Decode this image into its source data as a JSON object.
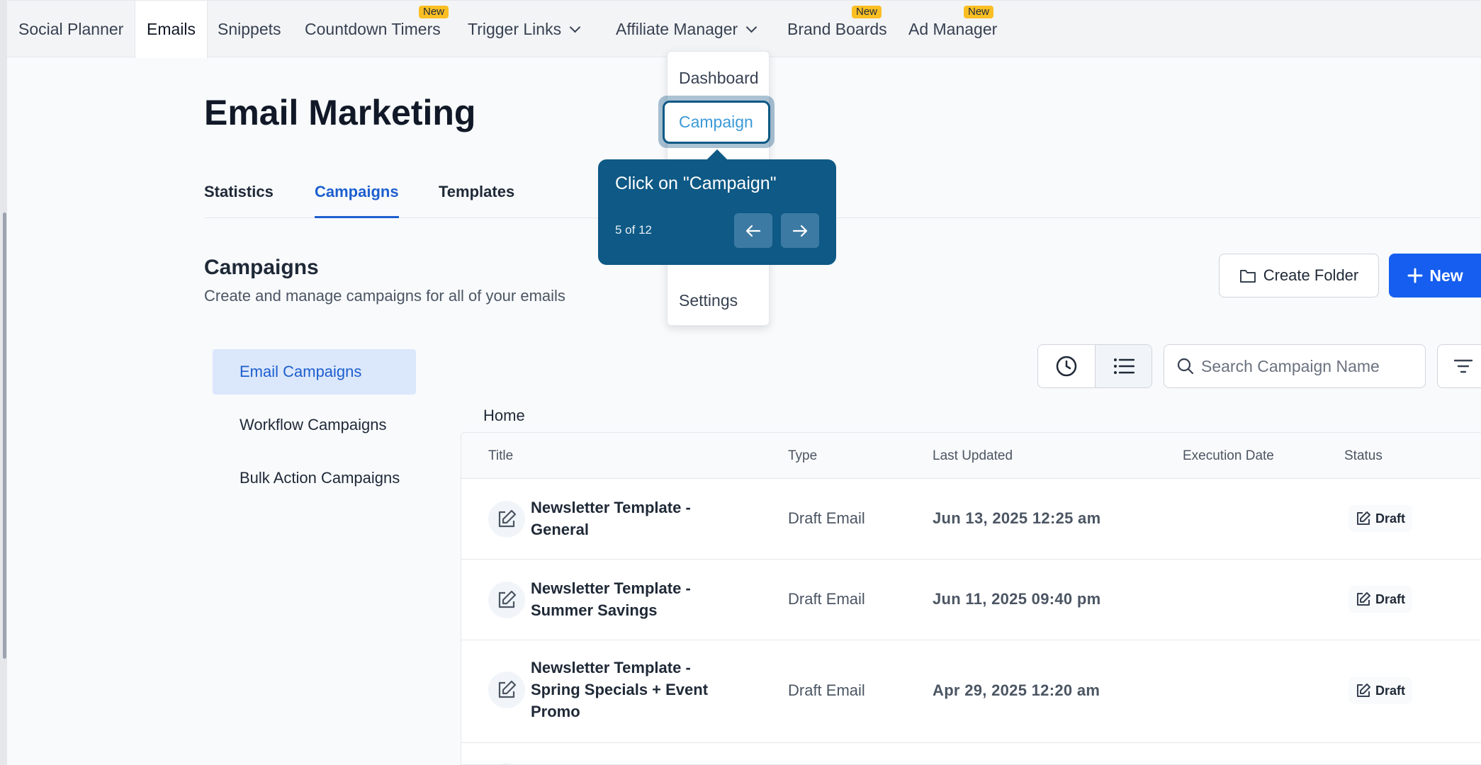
{
  "nav": {
    "items": [
      {
        "label": "Social Planner"
      },
      {
        "label": "Emails"
      },
      {
        "label": "Snippets"
      },
      {
        "label": "Countdown Timers",
        "badge": "New"
      },
      {
        "label": "Trigger Links"
      },
      {
        "label": "Affiliate Manager"
      },
      {
        "label": "Brand Boards",
        "badge": "New"
      },
      {
        "label": "Ad Manager",
        "badge": "New"
      }
    ],
    "active": "Emails"
  },
  "dropdown": {
    "items": [
      "Dashboard",
      "Campaign",
      "Settings"
    ],
    "highlighted": "Campaign"
  },
  "tooltip": {
    "text": "Click on \"Campaign\"",
    "step": "5 of 12"
  },
  "page": {
    "title": "Email Marketing",
    "tabs": [
      "Statistics",
      "Campaigns",
      "Templates"
    ],
    "active_tab": "Campaigns",
    "section_title": "Campaigns",
    "section_subtitle": "Create and manage campaigns for all of your emails",
    "create_folder_label": "Create Folder",
    "new_label": "New"
  },
  "sidebar": {
    "items": [
      "Email Campaigns",
      "Workflow Campaigns",
      "Bulk Action Campaigns"
    ],
    "active": "Email Campaigns"
  },
  "toolbar": {
    "search_placeholder": "Search Campaign Name"
  },
  "breadcrumb": "Home",
  "table": {
    "columns": [
      "Title",
      "Type",
      "Last Updated",
      "Execution Date",
      "Status"
    ],
    "rows": [
      {
        "title": "Newsletter Template - General",
        "type": "Draft Email",
        "last_updated": "Jun 13, 2025 12:25 am",
        "execution_date": "",
        "status": "Draft"
      },
      {
        "title": "Newsletter Template - Summer Savings",
        "type": "Draft Email",
        "last_updated": "Jun 11, 2025 09:40 pm",
        "execution_date": "",
        "status": "Draft"
      },
      {
        "title": "Newsletter Template - Spring Specials + Event Promo",
        "type": "Draft Email",
        "last_updated": "Apr 29, 2025 12:20 am",
        "execution_date": "",
        "status": "Draft"
      }
    ]
  },
  "colors": {
    "primary": "#155eef",
    "tooltip": "#0e5985",
    "active_tab": "#1d5fcf",
    "badge": "#fbbf24"
  }
}
